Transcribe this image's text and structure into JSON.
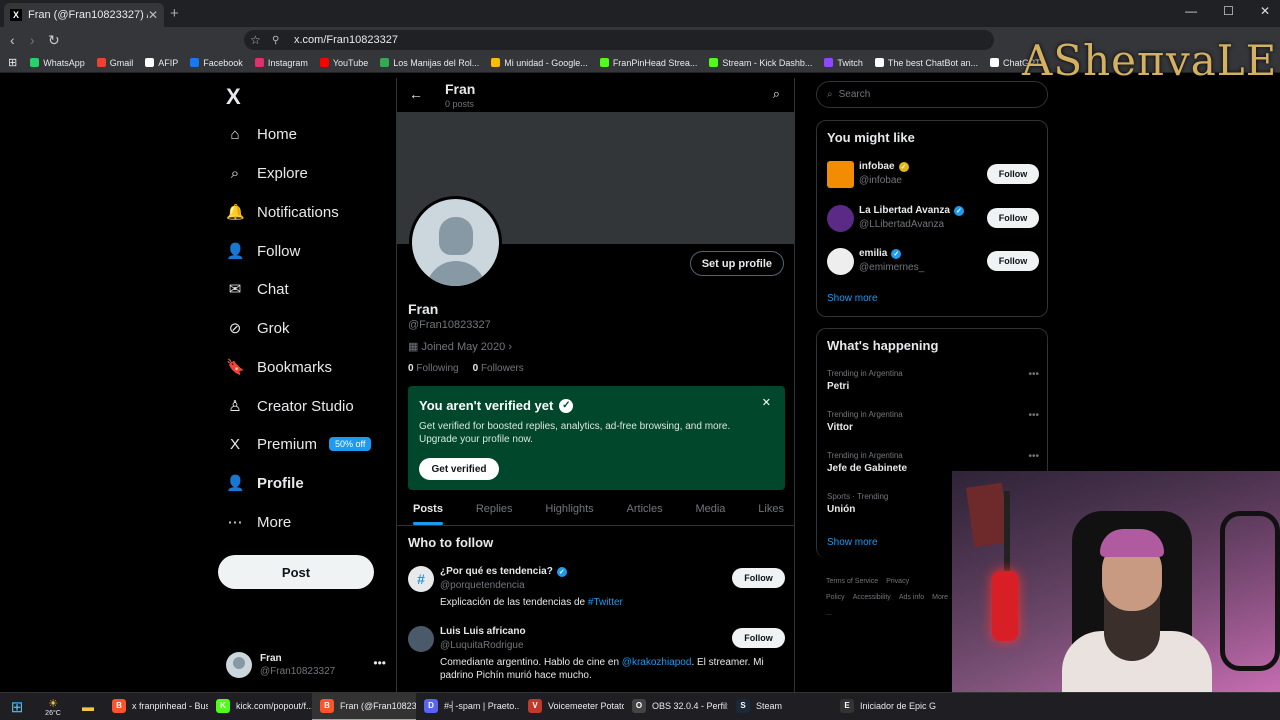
{
  "browser": {
    "tab_title": "Fran (@Fran10823327) / X",
    "tab_favicon": "X",
    "url": "x.com/Fran10823327",
    "bookmarks": [
      {
        "label": "WhatsApp",
        "color": "#25d366"
      },
      {
        "label": "Gmail",
        "color": "#ea4335"
      },
      {
        "label": "AFIP",
        "color": "#ffffff"
      },
      {
        "label": "Facebook",
        "color": "#1877f2"
      },
      {
        "label": "Instagram",
        "color": "#e1306c"
      },
      {
        "label": "YouTube",
        "color": "#ff0000"
      },
      {
        "label": "Los Manijas del Rol...",
        "color": "#34a853"
      },
      {
        "label": "Mi unidad - Google...",
        "color": "#fbbc04"
      },
      {
        "label": "FranPinHead Strea...",
        "color": "#53fc18"
      },
      {
        "label": "Stream - Kick Dashb...",
        "color": "#53fc18"
      },
      {
        "label": "Twitch",
        "color": "#9146ff"
      },
      {
        "label": "The best ChatBot an...",
        "color": "#ffffff"
      },
      {
        "label": "ChatGPT",
        "color": "#ffffff"
      }
    ]
  },
  "overlay": {
    "brand": "ASheпvaLE"
  },
  "nav": {
    "logo": "X",
    "items": [
      {
        "label": "Home",
        "icon": "home-icon",
        "glyph": "⌂"
      },
      {
        "label": "Explore",
        "icon": "search-icon",
        "glyph": "⌕"
      },
      {
        "label": "Notifications",
        "icon": "bell-icon",
        "glyph": "🔔"
      },
      {
        "label": "Follow",
        "icon": "add-user-icon",
        "glyph": "👤"
      },
      {
        "label": "Chat",
        "icon": "mail-icon",
        "glyph": "✉"
      },
      {
        "label": "Grok",
        "icon": "grok-icon",
        "glyph": "⊘"
      },
      {
        "label": "Bookmarks",
        "icon": "bookmark-icon",
        "glyph": "🔖"
      },
      {
        "label": "Creator Studio",
        "icon": "creator-icon",
        "glyph": "♙"
      },
      {
        "label": "Premium",
        "icon": "x-premium-icon",
        "glyph": "X"
      },
      {
        "label": "Profile",
        "icon": "profile-icon",
        "glyph": "👤"
      },
      {
        "label": "More",
        "icon": "more-icon",
        "glyph": "⋯"
      }
    ],
    "premium_badge": "50% off",
    "post_label": "Post",
    "account": {
      "name": "Fran",
      "handle": "@Fran10823327"
    }
  },
  "profile": {
    "header_name": "Fran",
    "header_posts": "0 posts",
    "setup_label": "Set up profile",
    "name": "Fran",
    "handle": "@Fran10823327",
    "joined": "Joined May 2020",
    "following_count": "0",
    "following_label": "Following",
    "followers_count": "0",
    "followers_label": "Followers",
    "verify": {
      "title": "You aren't verified yet",
      "desc": "Get verified for boosted replies, analytics, ad-free browsing, and more. Upgrade your profile now.",
      "button": "Get verified"
    },
    "tabs": [
      "Posts",
      "Replies",
      "Highlights",
      "Articles",
      "Media",
      "Likes"
    ],
    "who_to_follow_title": "Who to follow",
    "suggestions": [
      {
        "name": "¿Por qué es tendencia?",
        "handle": "@porquetendencia",
        "bio_pre": "Explicación de las tendencias de ",
        "bio_link": "#Twitter",
        "bio_post": "",
        "follow": "Follow"
      },
      {
        "name": "Luis Luis africano",
        "handle": "@LuquitaRodrigue",
        "bio_pre": "Comediante argentino. Hablo de cine en ",
        "bio_link": "@krakozhiapod",
        "bio_post": ". El streamer. Mi padrino Pichín murió hace mucho.",
        "follow": "Follow"
      }
    ]
  },
  "right": {
    "search_placeholder": "Search",
    "might_like_title": "You might like",
    "might_like": [
      {
        "name": "infobae",
        "handle": "@infobae",
        "badge": "gold",
        "follow": "Follow",
        "avatar_color": "#f28c00"
      },
      {
        "name": "La Libertad Avanza",
        "handle": "@LLibertadAvanza",
        "badge": "blue",
        "follow": "Follow",
        "avatar_color": "#5b2a86"
      },
      {
        "name": "emilia",
        "handle": "@emimernes_",
        "badge": "blue",
        "follow": "Follow",
        "avatar_color": "#eeeeee"
      }
    ],
    "show_more": "Show more",
    "happening_title": "What's happening",
    "trends": [
      {
        "context": "Trending in Argentina",
        "name": "Petri"
      },
      {
        "context": "Trending in Argentina",
        "name": "Vittor"
      },
      {
        "context": "Trending in Argentina",
        "name": "Jefe de Gabinete"
      },
      {
        "context": "Sports · Trending",
        "name": "Unión"
      }
    ],
    "show_more_2": "Show more",
    "footer": [
      "Terms of Service",
      "Privacy Policy",
      "Accessibility",
      "Ads info",
      "More ..."
    ]
  },
  "taskbar": {
    "weather": "26°C",
    "apps": [
      {
        "label": "x franpinhead - Bus...",
        "color": "#fb542b",
        "glyph": "B"
      },
      {
        "label": "kick.com/popout/f...",
        "color": "#53fc18",
        "glyph": "K"
      },
      {
        "label": "Fran (@Fran10823...",
        "color": "#fb542b",
        "glyph": "B",
        "active": true
      },
      {
        "label": "#╡-spam | Praeto...",
        "color": "#5865f2",
        "glyph": "D"
      },
      {
        "label": "Voicemeeter Potato",
        "color": "#c0392b",
        "glyph": "V"
      },
      {
        "label": "OBS 32.0.4 - Perfil:...",
        "color": "#444444",
        "glyph": "O"
      },
      {
        "label": "Steam",
        "color": "#1b2838",
        "glyph": "S"
      },
      {
        "label": "Iniciador de Epic G...",
        "color": "#333333",
        "glyph": "E"
      }
    ]
  }
}
